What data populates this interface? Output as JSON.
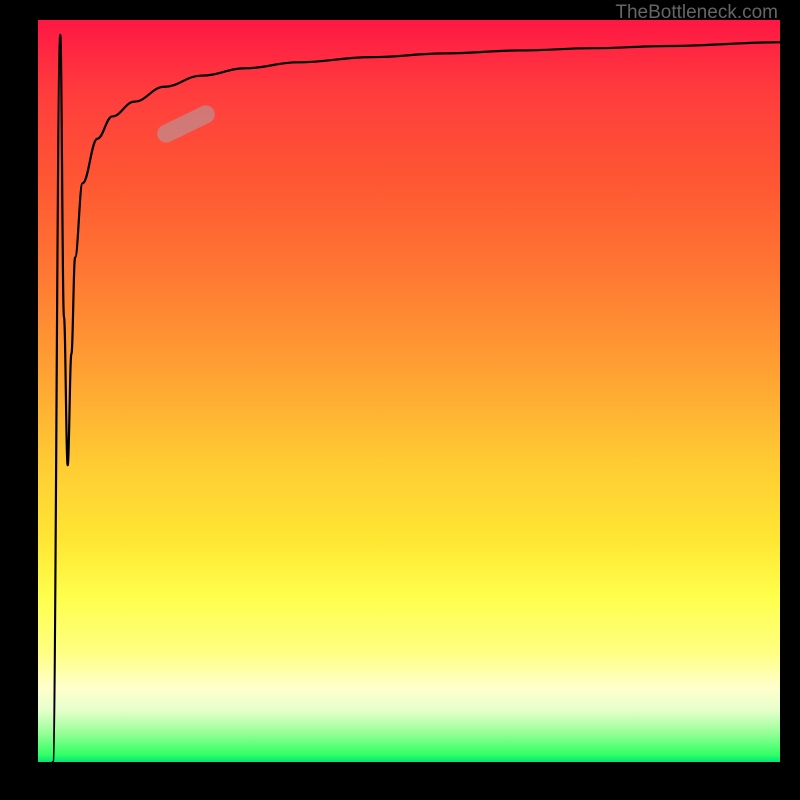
{
  "watermark": "TheBottleneck.com",
  "chart_data": {
    "type": "line",
    "title": "",
    "xlabel": "",
    "ylabel": "",
    "ylim": [
      0,
      100
    ],
    "xlim": [
      0,
      100
    ],
    "series": [
      {
        "name": "bottleneck-curve",
        "x": [
          2,
          3,
          3.5,
          4,
          4.5,
          5,
          6,
          8,
          10,
          13,
          17,
          22,
          28,
          35,
          45,
          55,
          65,
          75,
          85,
          100
        ],
        "y": [
          0,
          98,
          60,
          40,
          55,
          68,
          78,
          84,
          87,
          89,
          91,
          92.5,
          93.5,
          94.3,
          95,
          95.5,
          95.9,
          96.2,
          96.5,
          97
        ]
      }
    ],
    "highlight": {
      "x_center": 20,
      "y_center": 86
    }
  }
}
